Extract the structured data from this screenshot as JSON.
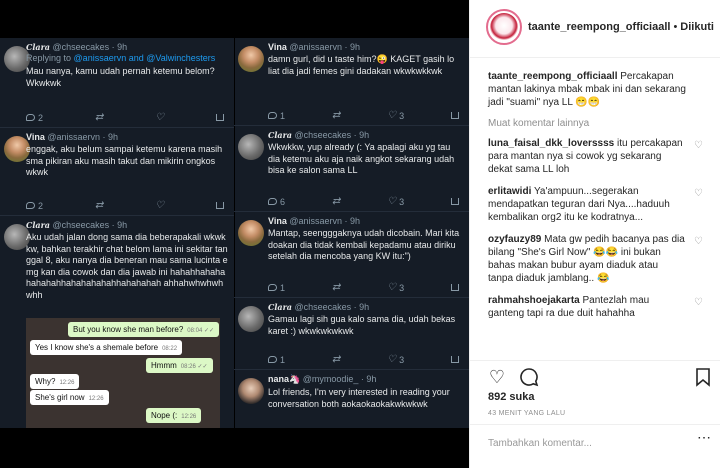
{
  "post": {
    "username": "taante_reempong_officiaall",
    "follow_state": "Diikuti",
    "caption_user": "taante_reempong_officiaall",
    "caption_text": "Percakapan mantan lakinya mbak mbak ini dan sekarang jadi \"suami\" nya LL 😁😁",
    "more_comments": "Muat komentar lainnya",
    "likes": "892 suka",
    "time_ago": "43 MENIT YANG LALU",
    "add_comment_placeholder": "Tambahkan komentar...",
    "comments": [
      {
        "user": "luna_faisal_dkk_loverssss",
        "text": "itu percakapan para mantan nya si cowok yg sekarang dekat sama LL loh"
      },
      {
        "user": "erlitawidi",
        "text": "Ya'ampuun...segerakan mendapatkan teguran dari Nya....haduuh kembalikan org2 itu ke kodratnya..."
      },
      {
        "user": "ozyfauzy89",
        "text": "Mata gw pedih bacanya pas dia bilang \"She's Girl Now\" 😂😂 ini bukan bahas makan bubur ayam diaduk atau tanpa diaduk jamblang.. 😂"
      },
      {
        "user": "rahmahshoejakarta",
        "text": "Pantezlah mau ganteng tapi ra due duit hahahha"
      }
    ]
  },
  "tweets_left": [
    {
      "name": "Clara",
      "handle": "@chseecakes · 9h",
      "replying": "Replying to",
      "mentions": "@anissaervn and @Valwinchesters",
      "text": "Mau nanya, kamu udah pernah ketemu belom? Wkwkwk",
      "replies": "2",
      "retweets": "",
      "likes": ""
    },
    {
      "name": "Vina",
      "handle": "@anissaervn · 9h",
      "text": "enggak, aku belum sampai ketemu karena masih sma pikiran aku masih takut dan mikirin ongkos wkwk",
      "replies": "2",
      "retweets": "",
      "likes": ""
    },
    {
      "name": "Clara",
      "handle": "@chseecakes · 9h",
      "text": "Aku udah jalan dong sama dia beberapakali wkwkkw, bahkan terakhir chat belom lama ini sekitar tanggal 8, aku nanya dia beneran mau sama lucinta emg kan dia cowok dan dia jawab ini hahahhahahahahahahhahahahahahhahahahah ahhahwhwhwhwhh",
      "chat": [
        {
          "text": "But you know she man before?",
          "time": "08:04 ✓✓",
          "me": true
        },
        {
          "text": "Yes I know she's a shemale before",
          "time": "08:22",
          "me": false
        },
        {
          "text": "Hmmm",
          "time": "08:26 ✓✓",
          "me": true
        },
        {
          "text": "Why?",
          "time": "12:26",
          "me": false
        },
        {
          "text": "She's girl now",
          "time": "12:26",
          "me": false
        },
        {
          "text": "Nope (:",
          "time": "12:26",
          "me": true
        }
      ]
    }
  ],
  "tweets_right": [
    {
      "name": "Vina",
      "handle": "@anissaervn · 9h",
      "text": "damn gurl, did u taste him?😜 KAGET gasih lo liat dia jadi femes gini dadakan wkwkwkkwk",
      "replies": "1",
      "retweets": "",
      "likes": "3"
    },
    {
      "name": "Clara",
      "handle": "@chseecakes · 9h",
      "text": "Wkwkkw, yup already (: Ya apalagi aku yg tau dia ketemu aku aja naik angkot sekarang udah bisa ke salon sama LL",
      "replies": "6",
      "retweets": "",
      "likes": "3"
    },
    {
      "name": "Vina",
      "handle": "@anissaervn · 9h",
      "text": "Mantap, seengggaknya udah dicobain. Mari kita doakan dia tidak kembali kepadamu atau diriku setelah dia mencoba yang KW itu:\")",
      "replies": "1",
      "retweets": "",
      "likes": "3"
    },
    {
      "name": "Clara",
      "handle": "@chseecakes · 9h",
      "text": "Gamau lagi sih gua kalo sama dia, udah bekas karet :) wkwkwkwkwk",
      "replies": "1",
      "retweets": "",
      "likes": "3"
    },
    {
      "name": "nana🦄",
      "handle": "@mymoodie_ · 9h",
      "text": "Lol friends, I'm very interested in reading your conversation both aokaokaokakwkwkwk"
    }
  ]
}
